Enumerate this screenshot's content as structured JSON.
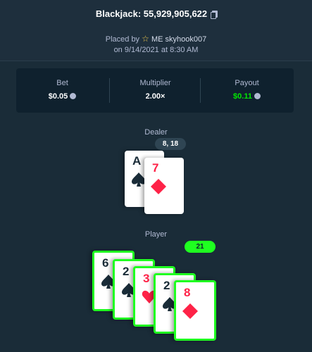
{
  "header": {
    "title": "Blackjack: 55,929,905,622",
    "placed_by_prefix": "Placed by",
    "user_tag": "ME",
    "username": "skyhook007",
    "date_text": "on 9/14/2021 at 8:30 AM"
  },
  "stats": {
    "bet_label": "Bet",
    "bet_value": "$0.05",
    "multiplier_label": "Multiplier",
    "multiplier_value": "2.00×",
    "payout_label": "Payout",
    "payout_value": "$0.11"
  },
  "dealer": {
    "label": "Dealer",
    "score": "8, 18",
    "cards": [
      {
        "rank": "A",
        "suit": "spades",
        "color": "black"
      },
      {
        "rank": "7",
        "suit": "diamonds",
        "color": "red"
      }
    ]
  },
  "player": {
    "label": "Player",
    "score": "21",
    "cards": [
      {
        "rank": "6",
        "suit": "spades",
        "color": "black"
      },
      {
        "rank": "2",
        "suit": "spades",
        "color": "black"
      },
      {
        "rank": "3",
        "suit": "hearts",
        "color": "red"
      },
      {
        "rank": "2",
        "suit": "spades",
        "color": "black"
      },
      {
        "rank": "8",
        "suit": "diamonds",
        "color": "red"
      }
    ]
  },
  "colors": {
    "background": "#1a2c38",
    "panel": "#0f212e",
    "win_green": "#1fff20",
    "payout_green": "#00e701",
    "red_suit": "#fe2247"
  }
}
